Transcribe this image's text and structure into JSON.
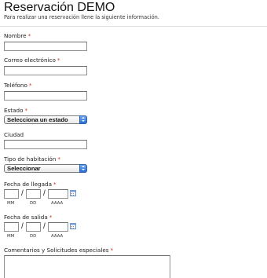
{
  "header": {
    "title": "Reservación DEMO",
    "subtitle": "Para realizar una reservación llene la siguiente información."
  },
  "form": {
    "required_marker": "*",
    "nombre": {
      "label": "Nombre",
      "value": ""
    },
    "correo": {
      "label": "Correo electrónico",
      "value": ""
    },
    "telefono": {
      "label": "Teléfono",
      "value": ""
    },
    "estado": {
      "label": "Estado",
      "selected": "Selecciona un estado"
    },
    "ciudad": {
      "label": "Ciudad",
      "value": ""
    },
    "tipo_habitacion": {
      "label": "Tipo de habitación",
      "selected": "Seleccionar"
    },
    "fecha_llegada": {
      "label": "Fecha de llegada",
      "separator": "/",
      "hints": {
        "mm": "MM",
        "dd": "DD",
        "aaaa": "AAAA"
      }
    },
    "fecha_salida": {
      "label": "Fecha de salida",
      "separator": "/",
      "hints": {
        "mm": "MM",
        "dd": "DD",
        "aaaa": "AAAA"
      }
    },
    "comentarios": {
      "label": "Comentarios y Solicitudes especiales",
      "value": ""
    }
  },
  "colors": {
    "required": "#c0392b",
    "select_arrow": "#2a6fd8"
  },
  "icons": {
    "calendar": "calendar-icon"
  }
}
